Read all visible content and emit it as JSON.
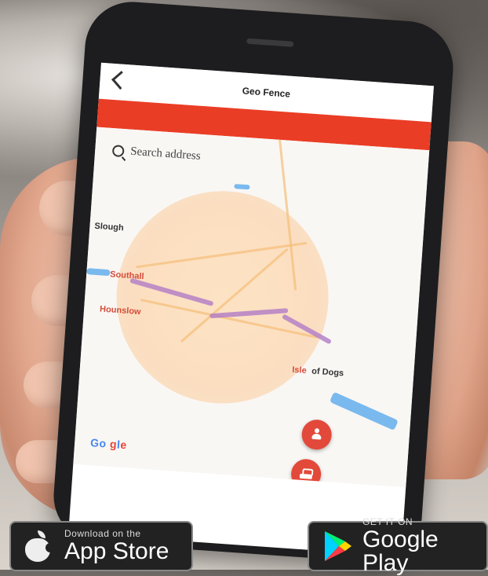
{
  "app": {
    "title": "Geo Fence"
  },
  "search": {
    "placeholder": "Search address"
  },
  "map_labels": {
    "top_left": "Slough",
    "left_red_1": "Southall",
    "left_red_2": "Hounslow",
    "right_prefix": "Isle",
    "right_suffix": "of Dogs"
  },
  "google": {
    "g1": "Go",
    "g2": "g",
    "g3": "l",
    "g4": "e"
  },
  "badges": {
    "app_store": {
      "small": "Download on the",
      "big": "App Store"
    },
    "google_play": {
      "small": "GET IT ON",
      "big": "Google Play"
    }
  },
  "colors": {
    "header_bar": "#ea3d25",
    "fab": "#e2493a",
    "fence": "#fde1be"
  },
  "icons": [
    "back-icon",
    "search-icon",
    "person-icon",
    "car-icon",
    "apple-icon",
    "play-icon"
  ]
}
